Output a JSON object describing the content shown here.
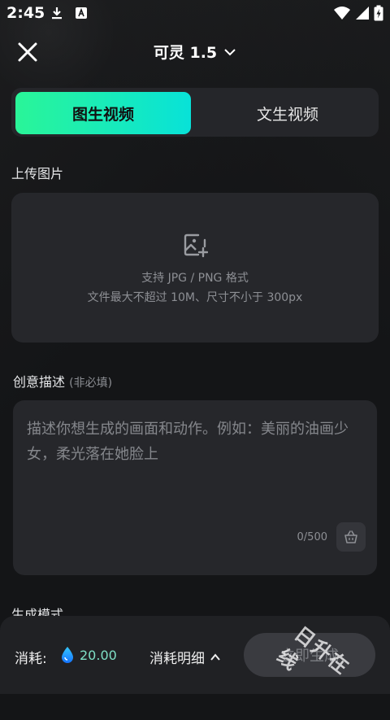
{
  "status_bar": {
    "time": "2:45",
    "icons": [
      "download-icon",
      "app-notification-icon",
      "wifi-icon",
      "signal-icon",
      "battery-charging-icon"
    ]
  },
  "header": {
    "model_name": "可灵 1.5",
    "close_icon": "close-icon",
    "chevron_icon": "chevron-down-icon"
  },
  "tabs": [
    {
      "label": "图生视频",
      "active": true
    },
    {
      "label": "文生视频",
      "active": false
    }
  ],
  "upload": {
    "title": "上传图片",
    "line1": "支持 JPG / PNG 格式",
    "line2": "文件最大不超过 10M、尺寸不小于 300px",
    "icon": "add-image-icon"
  },
  "prompt": {
    "title": "创意描述",
    "optional": "(非必填)",
    "placeholder": "描述你想生成的画面和动作。例如：美丽的油画少女，柔光落在她脸上",
    "count": "0/500",
    "clear_icon": "clear-basket-icon"
  },
  "gen_mode": {
    "title": "生成模式"
  },
  "footer": {
    "cost_label": "消耗:",
    "cost_value": "20.00",
    "detail_label": "消耗明细",
    "generate_label": "立即生成"
  },
  "watermark": "日升在线",
  "colors": {
    "accent_start": "#2af598",
    "accent_end": "#08e2d8",
    "background": "#141517",
    "card": "#26272b"
  }
}
